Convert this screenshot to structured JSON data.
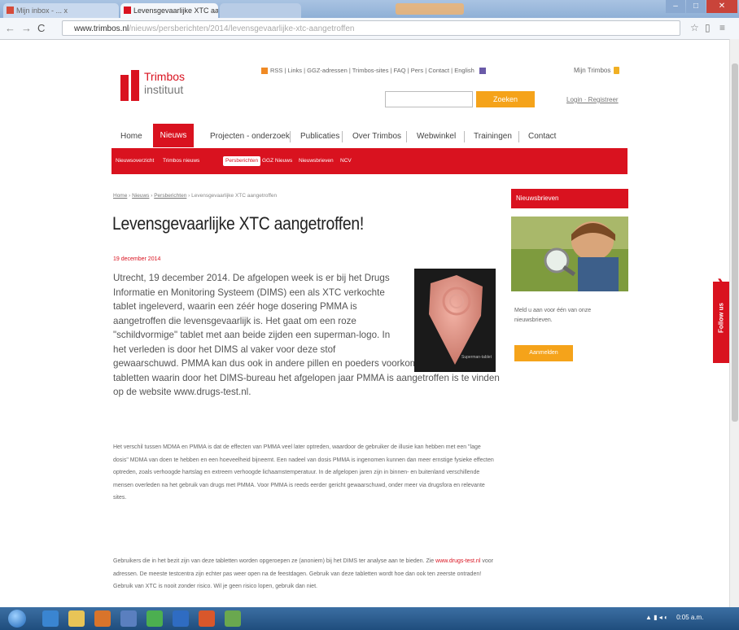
{
  "browser": {
    "tabs": [
      {
        "label": "Mijn inbox - ... x",
        "active": false
      },
      {
        "label": "Levensgevaarlijke XTC aa... x",
        "active": true
      },
      {
        "label": "",
        "active": false
      }
    ],
    "url_domain": "www.trimbos.nl",
    "url_path": "/nieuws/persberichten/2014/levensgevaarlijke-xtc-aangetroffen",
    "back_icon": "arrow-left-icon",
    "forward_icon": "arrow-right-icon",
    "reload_icon": "reload-icon",
    "star_icon": "star-icon",
    "menu_icon": "menu-icon"
  },
  "site": {
    "logo_line1": "Trimbos",
    "logo_line2": "instituut",
    "top_links": "RSS | Links | GGZ-adressen | Trimbos-sites | FAQ | Pers | Contact | English",
    "my_trimbos": "Mijn Trimbos",
    "search_button": "Zoeken",
    "login": "Login · Registreer",
    "colors": {
      "brand_red": "#d9121f",
      "accent_orange": "#f5a31a"
    }
  },
  "main_nav": [
    {
      "label": "Home",
      "active": false
    },
    {
      "label": "Nieuws",
      "active": true
    },
    {
      "label": "Projecten - onderzoek",
      "active": false
    },
    {
      "label": "Publicaties",
      "active": false
    },
    {
      "label": "Over Trimbos",
      "active": false
    },
    {
      "label": "Webwinkel",
      "active": false
    },
    {
      "label": "Trainingen",
      "active": false
    },
    {
      "label": "Contact",
      "active": false
    }
  ],
  "sub_nav": [
    {
      "label": "Nieuwsoverzicht",
      "active": false
    },
    {
      "label": "Trimbos nieuws",
      "active": false
    },
    {
      "label": "Persberichten",
      "active": true
    },
    {
      "label": "GGZ Nieuws",
      "active": false
    },
    {
      "label": "Nieuwsbrieven",
      "active": false
    },
    {
      "label": "NCV",
      "active": false
    }
  ],
  "article": {
    "breadcrumb_home": "Home",
    "breadcrumb_news": "Nieuws",
    "breadcrumb_press": "Persberichten",
    "breadcrumb_current": "Levensgevaarlijke XTC aangetroffen",
    "title": "Levensgevaarlijke XTC aangetroffen!",
    "date": "19 december 2014",
    "intro": "Utrecht, 19 december 2014. De afgelopen week is er bij het Drugs Informatie en Monitoring Systeem (DIMS) een als XTC verkochte tablet ingeleverd, waarin een zéér hoge dosering PMMA is aangetroffen die levensgevaarlijk is. Het gaat om een roze \"schildvormige\" tablet met aan beide zijden een superman-logo. In het verleden is door het DIMS al vaker voor deze stof",
    "intro_tail": "gewaarschuwd. PMMA kan dus ook in andere pillen en poeders voorkomen. Een lijst van tabletten waarin door het DIMS-bureau het afgelopen jaar PMMA is aangetroffen is te vinden op de website www.drugs-test.nl.",
    "image_caption": "Superman-tablet",
    "para1": "Het verschil tussen MDMA en PMMA is dat de effecten van PMMA veel later optreden, waardoor de gebruiker de illusie kan hebben met een \"lage dosis\" MDMA van doen te hebben en een hoeveelheid bijneemt. Een nadeel van dosis PMMA is ingenomen kunnen dan meer ernstige fysieke effecten optreden, zoals verhoogde hartslag en extreem verhoogde lichaamstemperatuur. In de afgelopen jaren zijn in binnen- en buitenland verschillende mensen overleden na het gebruik van drugs met PMMA. Voor PMMA is reeds eerder gericht gewaarschuwd, onder meer via drugsfora en relevante sites.",
    "para2_start": "Gebruikers die in het bezit zijn van deze tabletten worden opgeroepen ze (anoniem) bij het DIMS ter analyse aan te bieden. Zie",
    "para2_link": "www.drugs-test.nl",
    "para2_end": "voor adressen. De meeste testcentra zijn echter pas weer open na de feestdagen. Gebruik van deze tabletten wordt hoe dan ook ten zeerste ontraden! Gebruik van XTC is nooit zonder risico. Wil je geen risico lopen, gebruik dan niet."
  },
  "sidebar": {
    "heading": "Nieuwsbrieven",
    "text": "Meld u aan voor één van onze nieuwsbrieven.",
    "button": "Aanmelden",
    "follow": "Follow us"
  },
  "taskbar": {
    "clock": "0:05 a.m."
  }
}
